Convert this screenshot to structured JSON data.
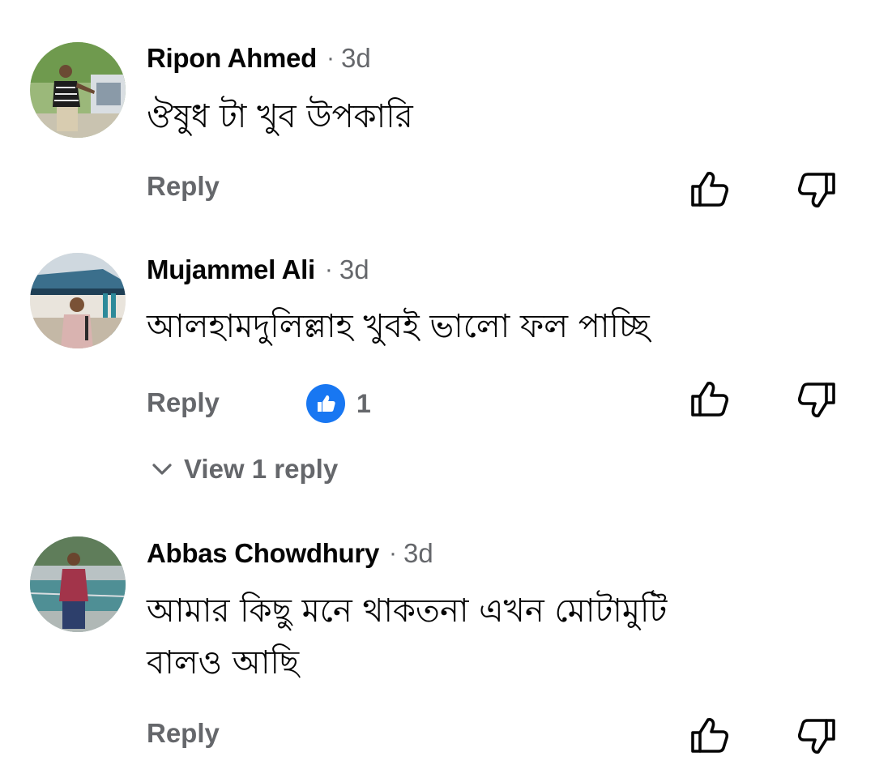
{
  "comments": [
    {
      "author": "Ripon Ahmed",
      "separator": "·",
      "time": "3d",
      "text_lines": [
        "ঔষুধ টা খুব উপকারি"
      ],
      "reply_label": "Reply"
    },
    {
      "author": "Mujammel Ali",
      "separator": "·",
      "time": "3d",
      "text_lines": [
        "আলহামদুলিল্লাহ খুবই ভালো ফল পাচ্ছি"
      ],
      "reply_label": "Reply",
      "reaction_count": "1",
      "view_replies_label": "View 1 reply"
    },
    {
      "author": "Abbas Chowdhury",
      "separator": "·",
      "time": "3d",
      "text_lines": [
        "আমার কিছু মনে থাকতনা এখন মোটামুটি",
        "বালও আছি"
      ],
      "reply_label": "Reply"
    }
  ],
  "icons": {
    "like": "thumbs-up-outline-icon",
    "dislike": "thumbs-down-outline-icon",
    "reaction": "like-reaction-icon",
    "chevron": "chevron-down-icon"
  },
  "colors": {
    "meta_text": "#65676b",
    "primary_text": "#050505",
    "reaction_blue": "#1877f2"
  }
}
